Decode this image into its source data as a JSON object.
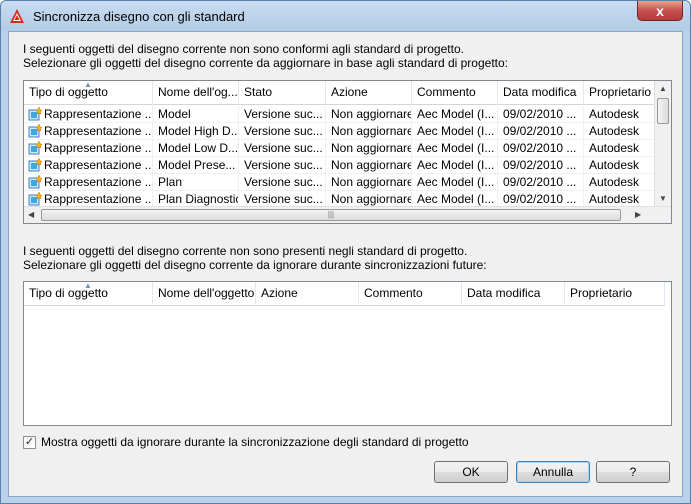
{
  "window": {
    "title": "Sincronizza disegno con gli standard",
    "close_label": "x"
  },
  "section1": {
    "line1": "I seguenti oggetti del disegno corrente non sono conformi agli standard di progetto.",
    "line2": "Selezionare gli oggetti del disegno corrente da aggiornare in base agli standard di progetto:",
    "columns": [
      "Tipo di oggetto",
      "Nome dell'oggetto",
      "Stato",
      "Azione",
      "Commento",
      "Data modifica",
      "Proprietario"
    ],
    "columns_shown": [
      "Tipo di oggetto",
      "Nome dell'og...",
      "Stato",
      "Azione",
      "Commento",
      "Data modifica",
      "Proprietario"
    ],
    "rows": [
      [
        "Rappresentazione ...",
        "Model",
        "Versione suc...",
        "Non aggiornare",
        "Aec Model (I...",
        "09/02/2010 ...",
        "Autodesk"
      ],
      [
        "Rappresentazione ...",
        "Model High D...",
        "Versione suc...",
        "Non aggiornare",
        "Aec Model (I...",
        "09/02/2010 ...",
        "Autodesk"
      ],
      [
        "Rappresentazione ...",
        "Model Low D...",
        "Versione suc...",
        "Non aggiornare",
        "Aec Model (I...",
        "09/02/2010 ...",
        "Autodesk"
      ],
      [
        "Rappresentazione ...",
        "Model Prese...",
        "Versione suc...",
        "Non aggiornare",
        "Aec Model (I...",
        "09/02/2010 ...",
        "Autodesk"
      ],
      [
        "Rappresentazione ...",
        "Plan",
        "Versione suc...",
        "Non aggiornare",
        "Aec Model (I...",
        "09/02/2010 ...",
        "Autodesk"
      ],
      [
        "Rappresentazione ...",
        "Plan Diagnostic",
        "Versione suc...",
        "Non aggiornare",
        "Aec Model (I...",
        "09/02/2010 ...",
        "Autodesk"
      ]
    ]
  },
  "section2": {
    "line1": "I seguenti oggetti del disegno corrente non sono presenti negli standard di progetto.",
    "line2": "Selezionare gli oggetti del disegno corrente da ignorare durante sincronizzazioni future:",
    "columns": [
      "Tipo di oggetto",
      "Nome dell'oggetto",
      "Azione",
      "Commento",
      "Data modifica",
      "Proprietario"
    ]
  },
  "options": {
    "show_ignored_label": "Mostra oggetti da ignorare durante la sincronizzazione degli standard di progetto",
    "show_ignored_checked": true
  },
  "buttons": {
    "ok": "OK",
    "cancel": "Annulla",
    "help": "?"
  },
  "colors": {
    "frame": "#b9d1ea",
    "close": "#c75050",
    "client": "#f0f0f0"
  },
  "icons": {
    "app": "autocad-logo-icon",
    "row": "display-representation-icon"
  }
}
